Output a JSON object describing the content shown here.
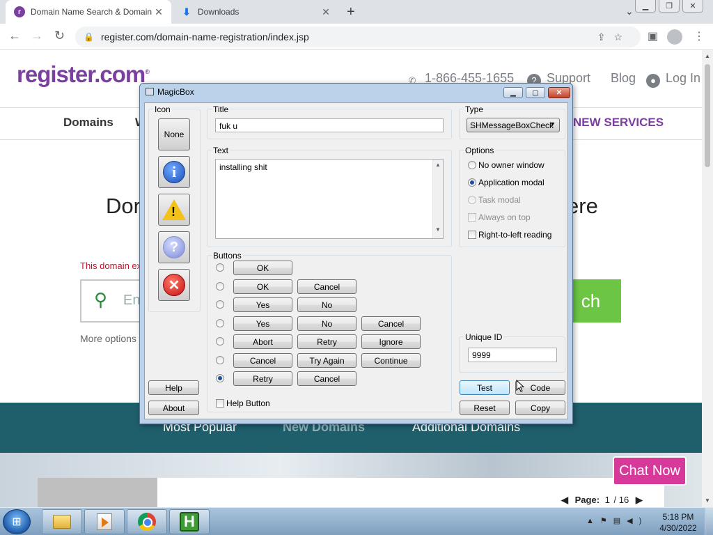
{
  "browser": {
    "tabs": [
      {
        "title": "Domain Name Search & Domain",
        "favicon": "register-favicon"
      },
      {
        "title": "Downloads",
        "favicon": "download-icon"
      }
    ],
    "url": "register.com/domain-name-registration/index.jsp"
  },
  "site": {
    "logo": "register.com",
    "phone": "1-866-455-1655",
    "support": "Support",
    "blog": "Blog",
    "login": "Log In",
    "nav": {
      "domains": "Domains",
      "w": "W",
      "new_services": "NEW SERVICES"
    },
    "hero_left": "Dor",
    "hero_right": "ere",
    "error_text": "This domain ex",
    "search_placeholder": "Ent",
    "search_button": "ch",
    "more_options": "More options",
    "bottom_tabs": [
      "Most Popular",
      "New Domains",
      "Additional Domains"
    ],
    "selected_bottom_tab": "New Domains",
    "pager": {
      "label": "Page:",
      "current": "1",
      "total": "/ 16"
    },
    "chat": "Chat Now"
  },
  "dialog": {
    "title": "MagicBox",
    "icon_group": "Icon",
    "icon_none": "None",
    "title_group": "Title",
    "title_value": "fuk u",
    "text_group": "Text",
    "text_value": "installing shit",
    "type_group": "Type",
    "type_value": "SHMessageBoxCheck",
    "options_group": "Options",
    "options": [
      {
        "label": "No owner window",
        "kind": "radio",
        "checked": false,
        "enabled": true
      },
      {
        "label": "Application modal",
        "kind": "radio",
        "checked": true,
        "enabled": true
      },
      {
        "label": "Task modal",
        "kind": "radio",
        "checked": false,
        "enabled": false
      },
      {
        "label": "Always on top",
        "kind": "check",
        "checked": false,
        "enabled": false
      },
      {
        "label": "Right-to-left reading",
        "kind": "check",
        "checked": false,
        "enabled": true
      }
    ],
    "buttons_group": "Buttons",
    "button_rows": [
      {
        "selected": false,
        "buttons": [
          "OK"
        ]
      },
      {
        "selected": false,
        "buttons": [
          "OK",
          "Cancel"
        ]
      },
      {
        "selected": false,
        "buttons": [
          "Yes",
          "No"
        ]
      },
      {
        "selected": false,
        "buttons": [
          "Yes",
          "No",
          "Cancel"
        ]
      },
      {
        "selected": false,
        "buttons": [
          "Abort",
          "Retry",
          "Ignore"
        ]
      },
      {
        "selected": false,
        "buttons": [
          "Cancel",
          "Try Again",
          "Continue"
        ]
      },
      {
        "selected": true,
        "buttons": [
          "Retry",
          "Cancel"
        ]
      }
    ],
    "help_button_check": "Help Button",
    "unique_id_group": "Unique ID",
    "unique_id_value": "9999",
    "help": "Help",
    "about": "About",
    "test": "Test",
    "code": "Code",
    "reset": "Reset",
    "copy": "Copy"
  },
  "taskbar": {
    "time": "5:18 PM",
    "date": "4/30/2022"
  }
}
